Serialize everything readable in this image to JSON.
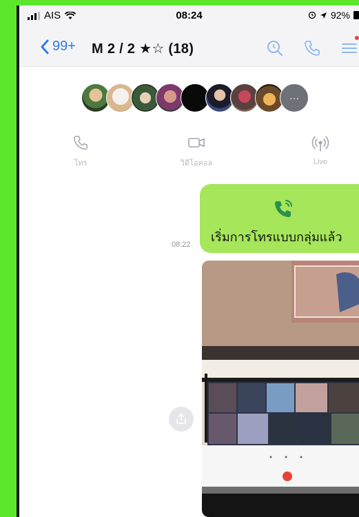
{
  "status_bar": {
    "carrier": "AIS",
    "time": "08:24",
    "battery": "92%"
  },
  "nav": {
    "back_count": "99+",
    "title": "M 2 / 2 ★☆ (18)"
  },
  "members": {
    "avatars": [
      "member-1",
      "member-2",
      "member-3",
      "member-4",
      "member-5",
      "member-6",
      "member-7",
      "member-8"
    ],
    "more_label": "···"
  },
  "actions": {
    "call_label": "โทร",
    "video_label": "วิดีโอคอล",
    "live_label": "Live"
  },
  "chat": {
    "group_call_text": "เริ่มการโทรแบบกลุ่มแล้ว",
    "message_time": "08:22"
  },
  "colors": {
    "accent_blue": "#2f7de1",
    "bubble_green": "#a5e65a",
    "background_green": "#5ee62c"
  }
}
